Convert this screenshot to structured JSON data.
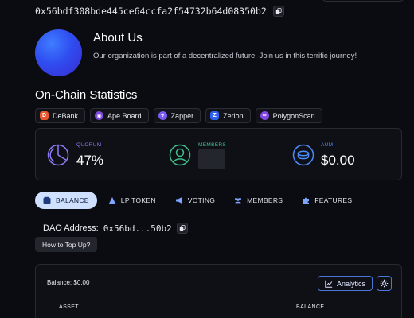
{
  "header": {
    "address": "0x56bdf308bde445ce64ccfa2f54732b64d08350b2"
  },
  "about": {
    "title": "About Us",
    "description": "Our organization is part of a decentralized future. Join us in this terrific journey!"
  },
  "stats": {
    "title": "On-Chain Statistics",
    "links": [
      {
        "label": "DeBank",
        "icon": "debank-icon",
        "color": "#e8552f"
      },
      {
        "label": "Ape Board",
        "icon": "apeboard-icon",
        "color": "#7b4bd8"
      },
      {
        "label": "Zapper",
        "icon": "zapper-icon",
        "color": "#7a5cf5"
      },
      {
        "label": "Zerion",
        "icon": "zerion-icon",
        "color": "#2f62f1"
      },
      {
        "label": "PolygonScan",
        "icon": "polygonscan-icon",
        "color": "#8247e5"
      }
    ],
    "quorum": {
      "label": "QUORUM",
      "value": "47%",
      "color": "#8b7cf6"
    },
    "members": {
      "label": "MEMBERS",
      "color": "#3fbf8a"
    },
    "aum": {
      "label": "AUM",
      "value": "$0.00",
      "color": "#4c8dff"
    }
  },
  "tabs": [
    {
      "label": "BALANCE",
      "icon": "wallet-icon",
      "active": true
    },
    {
      "label": "LP TOKEN",
      "icon": "lp-token-icon",
      "active": false
    },
    {
      "label": "VOTING",
      "icon": "megaphone-icon",
      "active": false
    },
    {
      "label": "MEMBERS",
      "icon": "users-icon",
      "active": false
    },
    {
      "label": "FEATURES",
      "icon": "puzzle-icon",
      "active": false
    }
  ],
  "dao": {
    "label": "DAO Address:",
    "value": "0x56bd...50b2",
    "topup": "How to Top Up?"
  },
  "balance_panel": {
    "balance_label": "Balance:",
    "balance_value": "$0.00",
    "analytics": "Analytics",
    "columns": {
      "asset": "ASSET",
      "balance": "BALANCE"
    }
  }
}
